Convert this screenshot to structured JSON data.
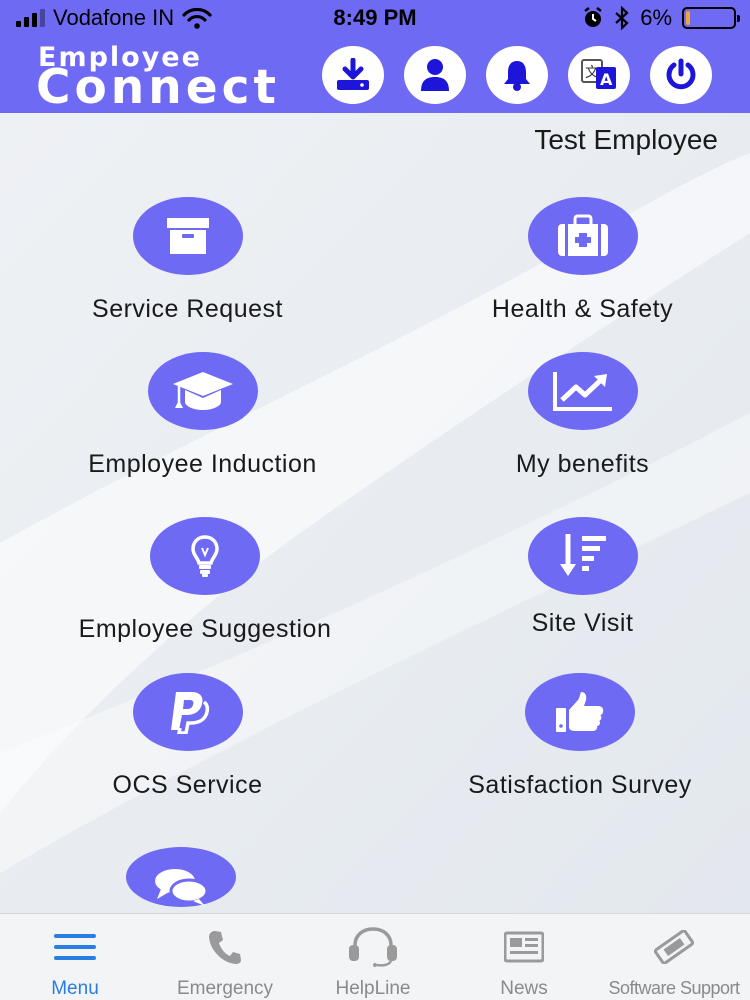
{
  "status_bar": {
    "carrier": "Vodafone IN",
    "time": "8:49 PM",
    "battery": "6%"
  },
  "header": {
    "logo": {
      "line1": "Employee",
      "line2": "Connect"
    },
    "buttons": [
      {
        "icon": "download-icon"
      },
      {
        "icon": "user-icon"
      },
      {
        "icon": "bell-icon"
      },
      {
        "icon": "translate-icon"
      },
      {
        "icon": "power-icon"
      }
    ]
  },
  "user_name": "Test Employee",
  "tiles": [
    {
      "label": "Service Request",
      "icon": "archive-box-icon"
    },
    {
      "label": "Health & Safety",
      "icon": "first-aid-kit-icon"
    },
    {
      "label": "Employee Induction",
      "icon": "graduation-cap-icon"
    },
    {
      "label": "My benefits",
      "icon": "trending-chart-icon"
    },
    {
      "label": "Employee Suggestion",
      "icon": "lightbulb-icon"
    },
    {
      "label": "Site Visit",
      "icon": "sort-list-icon"
    },
    {
      "label": "OCS Service",
      "icon": "paypal-icon"
    },
    {
      "label": "Satisfaction Survey",
      "icon": "thumbs-up-icon"
    },
    {
      "label": "",
      "icon": "chat-bubbles-icon"
    }
  ],
  "tabbar": [
    {
      "label": "Menu",
      "icon": "menu-icon",
      "active": true
    },
    {
      "label": "Emergency",
      "icon": "phone-icon"
    },
    {
      "label": "HelpLine",
      "icon": "headset-icon"
    },
    {
      "label": "News",
      "icon": "newspaper-icon"
    },
    {
      "label": "Software Support",
      "icon": "ticket-icon"
    }
  ],
  "colors": {
    "accent": "#6f6af3",
    "tab_active": "#2a7de1",
    "battery": "#f2a532"
  }
}
